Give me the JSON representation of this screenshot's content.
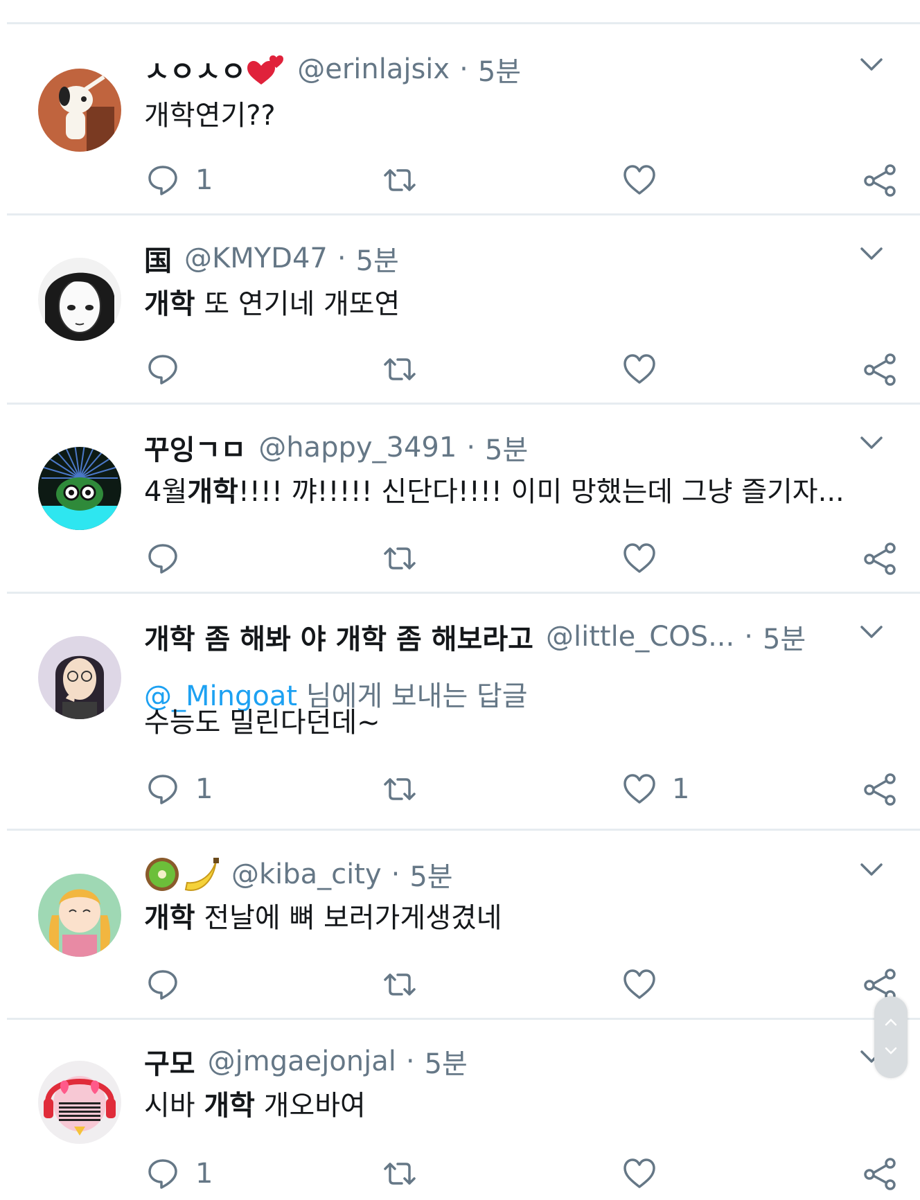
{
  "tweets": [
    {
      "name": "ㅅㅇㅅㅇ",
      "name_emoji": "two-hearts",
      "handle": "@erinlajsix",
      "separator": "·",
      "time": "5분",
      "text_parts": [
        {
          "text": "개학연기??",
          "bold": false
        }
      ],
      "reply_count": "1",
      "like_count": ""
    },
    {
      "name": "国",
      "handle": "@KMYD47",
      "separator": "·",
      "time": "5분",
      "text_parts": [
        {
          "text": "개학",
          "bold": true
        },
        {
          "text": " 또 연기네 개또연",
          "bold": false
        }
      ],
      "reply_count": "",
      "like_count": ""
    },
    {
      "name": "꾸잉ㄱㅁ",
      "handle": "@happy_3491",
      "separator": "·",
      "time": "5분",
      "text_parts": [
        {
          "text": "4월",
          "bold": false
        },
        {
          "text": "개학",
          "bold": true
        },
        {
          "text": "!!!! 꺄!!!!! 신단다!!!! 이미 망했는데 그냥 즐기자...",
          "bold": false
        }
      ],
      "reply_count": "",
      "like_count": ""
    },
    {
      "name": "개학 좀 해봐 야 개학 좀 해보라고",
      "handle": "@little_COS...",
      "separator": "·",
      "time": "5분",
      "reply_mention": "@_Mingoat",
      "reply_suffix": " 님에게 보내는 답글",
      "text_parts": [
        {
          "text": "수능도 밀린다던데~",
          "bold": false
        }
      ],
      "reply_count": "1",
      "like_count": "1"
    },
    {
      "name": "",
      "name_emoji": "kiwi-banana",
      "handle": "@kiba_city",
      "separator": "·",
      "time": "5분",
      "text_parts": [
        {
          "text": "개학",
          "bold": true
        },
        {
          "text": " 전날에 뼈 보러가게생겼네",
          "bold": false
        }
      ],
      "reply_count": "",
      "like_count": ""
    },
    {
      "name": "구모",
      "handle": "@jmgaejonjal",
      "separator": "·",
      "time": "5분",
      "text_parts": [
        {
          "text": "시바 ",
          "bold": false
        },
        {
          "text": "개학",
          "bold": true
        },
        {
          "text": " 개오바여",
          "bold": false
        }
      ],
      "reply_count": "1",
      "like_count": ""
    }
  ],
  "colors": {
    "text": "#14171a",
    "secondary": "#657786",
    "mention": "#1da1f2",
    "divider": "#e6ecf0"
  },
  "icons": [
    "reply-icon",
    "retweet-icon",
    "like-icon",
    "share-icon",
    "chevron-down-icon"
  ]
}
